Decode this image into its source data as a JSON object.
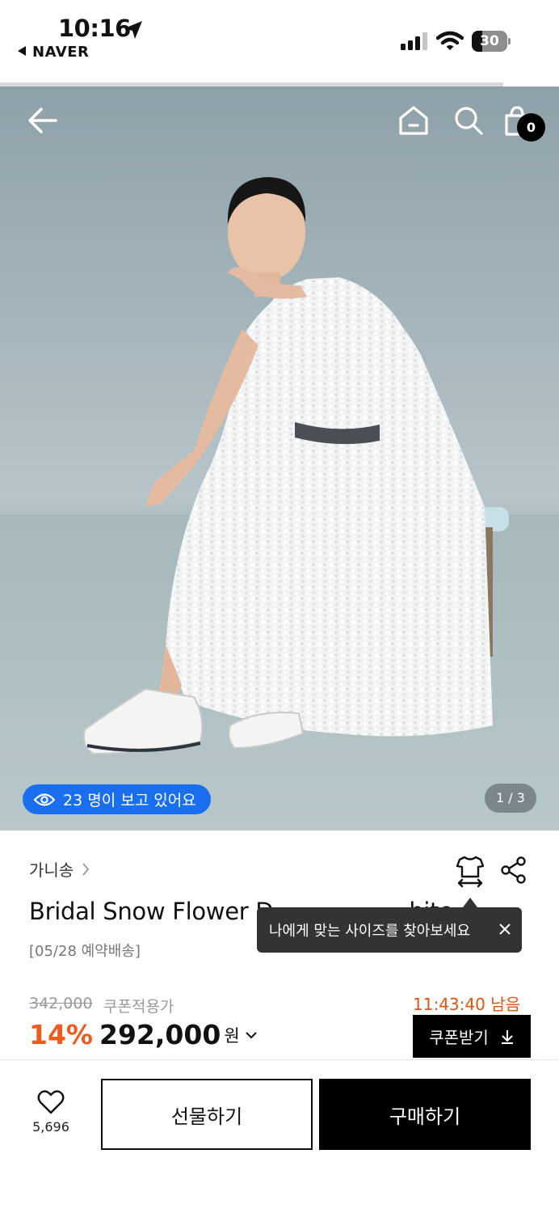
{
  "status_bar": {
    "time": "10:16",
    "back_app": "NAVER",
    "battery_level": "30"
  },
  "header": {
    "cart_count": "0"
  },
  "hero": {
    "viewers_text": "23 명이 보고 있어요",
    "page_counter": "1 / 3"
  },
  "product": {
    "brand": "가니송",
    "title": "Bridal Snow Flower D",
    "title_tail": "hite",
    "delivery_note": "[05/28 예약배송]",
    "tooltip": "나에게 맞는 사이즈를 찾아보세요"
  },
  "price": {
    "original": "342,000",
    "coupon_label": "쿠폰적용가",
    "timer": "11:43:40 남음",
    "discount": "14%",
    "sale": "292,000",
    "currency": "원",
    "coupon_button": "쿠폰받기"
  },
  "bottom_bar": {
    "like_count": "5,696",
    "gift_label": "선물하기",
    "buy_label": "구매하기"
  },
  "colors": {
    "accent_blue": "#1a6ff0",
    "discount_orange": "#ef5a1e",
    "timer_orange": "#e2530f"
  }
}
